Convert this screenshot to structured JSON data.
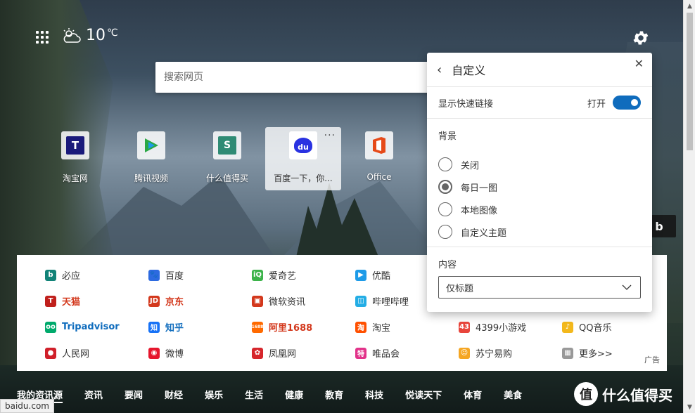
{
  "weather": {
    "temperature": "10",
    "unit": "℃"
  },
  "search": {
    "placeholder": "搜索网页"
  },
  "quick_links": [
    {
      "label": "淘宝网",
      "icon": "taobao-icon",
      "color": "#1a1a7a",
      "glyph": "T"
    },
    {
      "label": "腾讯视频",
      "icon": "tencent-video-icon",
      "color": "#2aa845",
      "glyph": "▶"
    },
    {
      "label": "什么值得买",
      "icon": "smzdm-icon",
      "color": "#2f8b74",
      "glyph": "S"
    },
    {
      "label": "百度一下，你...",
      "icon": "baidu-icon",
      "color": "#2932e1",
      "glyph": "du"
    },
    {
      "label": "Office",
      "icon": "office-icon",
      "color": "#e64a19",
      "glyph": "▮"
    }
  ],
  "quick_links_more": "···",
  "bing_button": "b",
  "links": [
    {
      "label": "必应",
      "icon": "bing-icon",
      "color": "#128378",
      "glyph": "b",
      "style": ""
    },
    {
      "label": "百度",
      "icon": "baidu-paw-icon",
      "color": "#2d6ae0",
      "glyph": "🐾",
      "style": ""
    },
    {
      "label": "爱奇艺",
      "icon": "iqiyi-icon",
      "color": "#3cb34a",
      "glyph": "iQ",
      "style": ""
    },
    {
      "label": "优酷",
      "icon": "youku-icon",
      "color": "#1e9be8",
      "glyph": "▶",
      "style": ""
    },
    {
      "label": "",
      "icon": "",
      "color": "",
      "glyph": "",
      "style": ""
    },
    {
      "label": "",
      "icon": "",
      "color": "",
      "glyph": "",
      "style": ""
    },
    {
      "label": "天猫",
      "icon": "tmall-icon",
      "color": "#c0201c",
      "glyph": "T",
      "style": "red"
    },
    {
      "label": "京东",
      "icon": "jd-icon",
      "color": "#d3381c",
      "glyph": "JD",
      "style": "red"
    },
    {
      "label": "微软资讯",
      "icon": "msn-news-icon",
      "color": "#d3381c",
      "glyph": "▣",
      "style": ""
    },
    {
      "label": "哔哩哔哩",
      "icon": "bilibili-icon",
      "color": "#23ade5",
      "glyph": "◫",
      "style": ""
    },
    {
      "label": "",
      "icon": "",
      "color": "",
      "glyph": "",
      "style": ""
    },
    {
      "label": "",
      "icon": "",
      "color": "",
      "glyph": "",
      "style": ""
    },
    {
      "label": "Tripadvisor",
      "icon": "tripadvisor-icon",
      "color": "#00aa6c",
      "glyph": "oo",
      "style": "blue"
    },
    {
      "label": "知乎",
      "icon": "zhihu-icon",
      "color": "#1772f6",
      "glyph": "知",
      "style": "blue"
    },
    {
      "label": "阿里1688",
      "icon": "ali1688-icon",
      "color": "#ff6a00",
      "glyph": "1688",
      "style": "red"
    },
    {
      "label": "淘宝",
      "icon": "taobao-small-icon",
      "color": "#ff5000",
      "glyph": "淘",
      "style": ""
    },
    {
      "label": "4399小游戏",
      "icon": "4399-icon",
      "color": "#e8453c",
      "glyph": "43",
      "style": ""
    },
    {
      "label": "QQ音乐",
      "icon": "qqmusic-icon",
      "color": "#f3b81c",
      "glyph": "♪",
      "style": ""
    },
    {
      "label": "人民网",
      "icon": "people-icon",
      "color": "#d0202a",
      "glyph": "●",
      "style": ""
    },
    {
      "label": "微博",
      "icon": "weibo-icon",
      "color": "#e6162d",
      "glyph": "◉",
      "style": ""
    },
    {
      "label": "凤凰网",
      "icon": "ifeng-icon",
      "color": "#d6262c",
      "glyph": "✿",
      "style": ""
    },
    {
      "label": "唯品会",
      "icon": "vip-icon",
      "color": "#e2338a",
      "glyph": "特",
      "style": ""
    },
    {
      "label": "苏宁易购",
      "icon": "suning-icon",
      "color": "#f5a623",
      "glyph": "☺",
      "style": ""
    },
    {
      "label": "更多>>",
      "icon": "more-sites-icon",
      "color": "#999999",
      "glyph": "▦",
      "style": ""
    }
  ],
  "ad_label": "广告",
  "bottom_nav": [
    "我的资讯源",
    "资讯",
    "要闻",
    "财经",
    "娱乐",
    "生活",
    "健康",
    "教育",
    "科技",
    "悦读天下",
    "体育",
    "美食"
  ],
  "status_url": "baidu.com",
  "watermark": {
    "logo": "值",
    "text": "什么值得买"
  },
  "customize": {
    "title": "自定义",
    "show_quick_links_label": "显示快速链接",
    "toggle_state": "打开",
    "background_title": "背景",
    "background_options": [
      "关闭",
      "每日一图",
      "本地图像",
      "自定义主题"
    ],
    "background_selected": 1,
    "content_title": "内容",
    "content_value": "仅标题"
  }
}
